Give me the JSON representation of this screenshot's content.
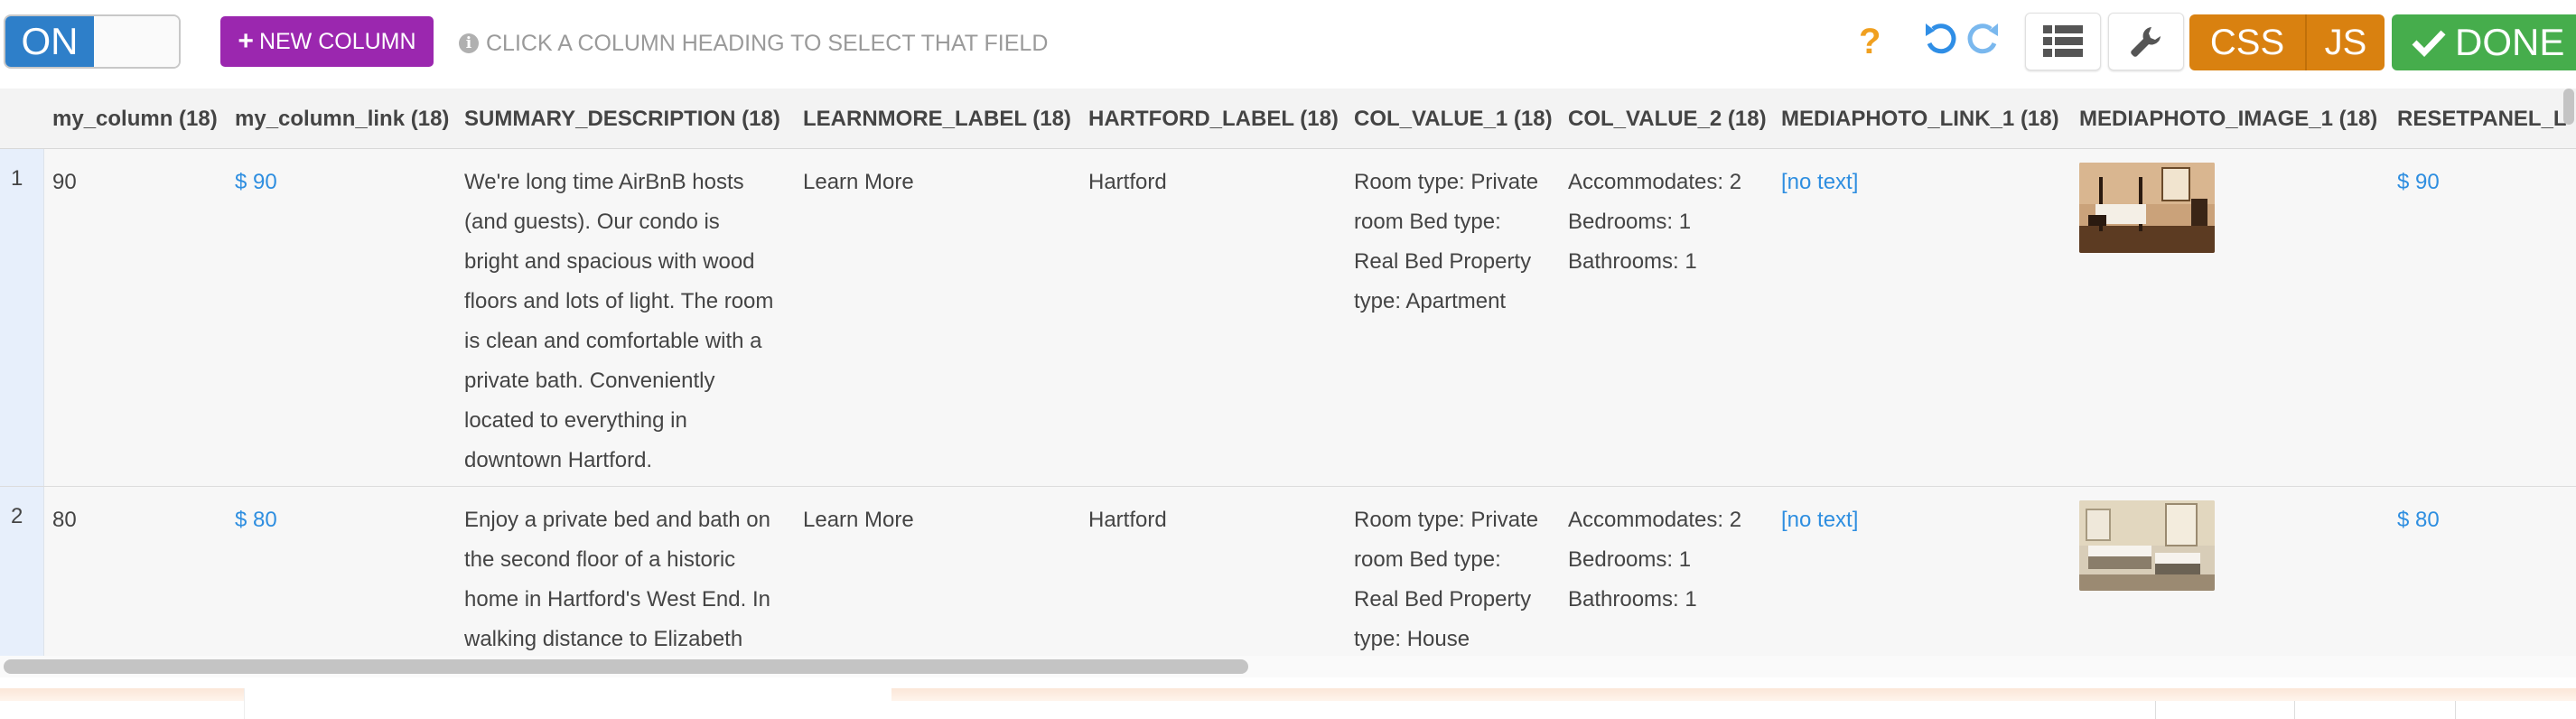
{
  "toolbar": {
    "toggle_on": "ON",
    "new_column_label": "NEW COLUMN",
    "hint": "CLICK A COLUMN HEADING TO SELECT THAT FIELD",
    "help_glyph": "?",
    "css_label": "CSS",
    "js_label": "JS",
    "done_label": "DONE"
  },
  "columns": [
    "my_column (18)",
    "my_column_link (18)",
    "SUMMARY_DESCRIPTION (18)",
    "LEARNMORE_LABEL (18)",
    "HARTFORD_LABEL (18)",
    "COL_VALUE_1 (18)",
    "COL_VALUE_2 (18)",
    "MEDIAPHOTO_LINK_1 (18)",
    "MEDIAPHOTO_IMAGE_1 (18)",
    "RESETPANEL_L"
  ],
  "rows": [
    {
      "num": "1",
      "my_column": "90",
      "my_column_link": "$ 90",
      "summary": [
        "We're long time AirBnB hosts",
        "(and guests). Our condo is",
        "bright and spacious with wood",
        "floors and lots of light. The room",
        "is clean and comfortable with a",
        "private bath. Conveniently",
        "located to everything in",
        "downtown Hartford."
      ],
      "learnmore": "Learn More",
      "hartford": "Hartford",
      "col_value_1": [
        "Room type: Private",
        "room Bed type:",
        "Real Bed Property",
        "type: Apartment"
      ],
      "col_value_2": [
        "Accommodates: 2",
        "Bedrooms: 1",
        "Bathrooms: 1"
      ],
      "photo_link": "[no text]",
      "resetpanel": "$ 90"
    },
    {
      "num": "2",
      "my_column": "80",
      "my_column_link": "$ 80",
      "summary": [
        "Enjoy a private bed and bath on",
        "the second floor of a historic",
        "home in Hartford's West End. In",
        "walking distance to Elizabeth"
      ],
      "learnmore": "Learn More",
      "hartford": "Hartford",
      "col_value_1": [
        "Room type: Private",
        "room Bed type:",
        "Real Bed Property",
        "type: House"
      ],
      "col_value_2": [
        "Accommodates: 2",
        "Bedrooms: 1",
        "Bathrooms: 1"
      ],
      "photo_link": "[no text]",
      "resetpanel": "$ 80"
    }
  ]
}
